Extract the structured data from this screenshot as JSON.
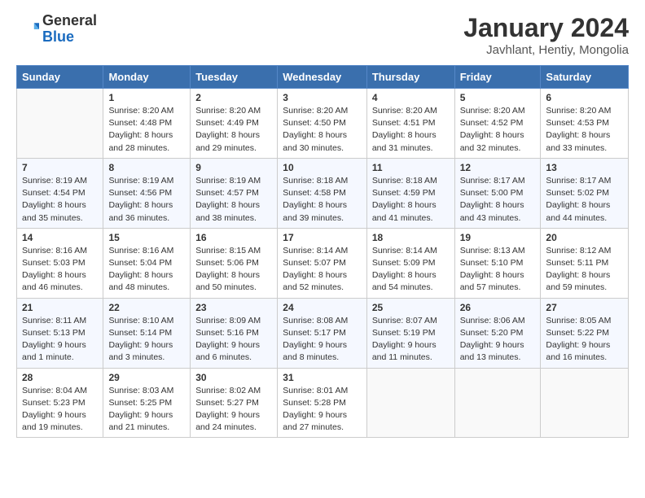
{
  "header": {
    "logo_general": "General",
    "logo_blue": "Blue",
    "month_title": "January 2024",
    "location": "Javhlant, Hentiy, Mongolia"
  },
  "weekdays": [
    "Sunday",
    "Monday",
    "Tuesday",
    "Wednesday",
    "Thursday",
    "Friday",
    "Saturday"
  ],
  "weeks": [
    [
      {
        "day": "",
        "sunrise": "",
        "sunset": "",
        "daylight": ""
      },
      {
        "day": "1",
        "sunrise": "Sunrise: 8:20 AM",
        "sunset": "Sunset: 4:48 PM",
        "daylight": "Daylight: 8 hours and 28 minutes."
      },
      {
        "day": "2",
        "sunrise": "Sunrise: 8:20 AM",
        "sunset": "Sunset: 4:49 PM",
        "daylight": "Daylight: 8 hours and 29 minutes."
      },
      {
        "day": "3",
        "sunrise": "Sunrise: 8:20 AM",
        "sunset": "Sunset: 4:50 PM",
        "daylight": "Daylight: 8 hours and 30 minutes."
      },
      {
        "day": "4",
        "sunrise": "Sunrise: 8:20 AM",
        "sunset": "Sunset: 4:51 PM",
        "daylight": "Daylight: 8 hours and 31 minutes."
      },
      {
        "day": "5",
        "sunrise": "Sunrise: 8:20 AM",
        "sunset": "Sunset: 4:52 PM",
        "daylight": "Daylight: 8 hours and 32 minutes."
      },
      {
        "day": "6",
        "sunrise": "Sunrise: 8:20 AM",
        "sunset": "Sunset: 4:53 PM",
        "daylight": "Daylight: 8 hours and 33 minutes."
      }
    ],
    [
      {
        "day": "7",
        "sunrise": "Sunrise: 8:19 AM",
        "sunset": "Sunset: 4:54 PM",
        "daylight": "Daylight: 8 hours and 35 minutes."
      },
      {
        "day": "8",
        "sunrise": "Sunrise: 8:19 AM",
        "sunset": "Sunset: 4:56 PM",
        "daylight": "Daylight: 8 hours and 36 minutes."
      },
      {
        "day": "9",
        "sunrise": "Sunrise: 8:19 AM",
        "sunset": "Sunset: 4:57 PM",
        "daylight": "Daylight: 8 hours and 38 minutes."
      },
      {
        "day": "10",
        "sunrise": "Sunrise: 8:18 AM",
        "sunset": "Sunset: 4:58 PM",
        "daylight": "Daylight: 8 hours and 39 minutes."
      },
      {
        "day": "11",
        "sunrise": "Sunrise: 8:18 AM",
        "sunset": "Sunset: 4:59 PM",
        "daylight": "Daylight: 8 hours and 41 minutes."
      },
      {
        "day": "12",
        "sunrise": "Sunrise: 8:17 AM",
        "sunset": "Sunset: 5:00 PM",
        "daylight": "Daylight: 8 hours and 43 minutes."
      },
      {
        "day": "13",
        "sunrise": "Sunrise: 8:17 AM",
        "sunset": "Sunset: 5:02 PM",
        "daylight": "Daylight: 8 hours and 44 minutes."
      }
    ],
    [
      {
        "day": "14",
        "sunrise": "Sunrise: 8:16 AM",
        "sunset": "Sunset: 5:03 PM",
        "daylight": "Daylight: 8 hours and 46 minutes."
      },
      {
        "day": "15",
        "sunrise": "Sunrise: 8:16 AM",
        "sunset": "Sunset: 5:04 PM",
        "daylight": "Daylight: 8 hours and 48 minutes."
      },
      {
        "day": "16",
        "sunrise": "Sunrise: 8:15 AM",
        "sunset": "Sunset: 5:06 PM",
        "daylight": "Daylight: 8 hours and 50 minutes."
      },
      {
        "day": "17",
        "sunrise": "Sunrise: 8:14 AM",
        "sunset": "Sunset: 5:07 PM",
        "daylight": "Daylight: 8 hours and 52 minutes."
      },
      {
        "day": "18",
        "sunrise": "Sunrise: 8:14 AM",
        "sunset": "Sunset: 5:09 PM",
        "daylight": "Daylight: 8 hours and 54 minutes."
      },
      {
        "day": "19",
        "sunrise": "Sunrise: 8:13 AM",
        "sunset": "Sunset: 5:10 PM",
        "daylight": "Daylight: 8 hours and 57 minutes."
      },
      {
        "day": "20",
        "sunrise": "Sunrise: 8:12 AM",
        "sunset": "Sunset: 5:11 PM",
        "daylight": "Daylight: 8 hours and 59 minutes."
      }
    ],
    [
      {
        "day": "21",
        "sunrise": "Sunrise: 8:11 AM",
        "sunset": "Sunset: 5:13 PM",
        "daylight": "Daylight: 9 hours and 1 minute."
      },
      {
        "day": "22",
        "sunrise": "Sunrise: 8:10 AM",
        "sunset": "Sunset: 5:14 PM",
        "daylight": "Daylight: 9 hours and 3 minutes."
      },
      {
        "day": "23",
        "sunrise": "Sunrise: 8:09 AM",
        "sunset": "Sunset: 5:16 PM",
        "daylight": "Daylight: 9 hours and 6 minutes."
      },
      {
        "day": "24",
        "sunrise": "Sunrise: 8:08 AM",
        "sunset": "Sunset: 5:17 PM",
        "daylight": "Daylight: 9 hours and 8 minutes."
      },
      {
        "day": "25",
        "sunrise": "Sunrise: 8:07 AM",
        "sunset": "Sunset: 5:19 PM",
        "daylight": "Daylight: 9 hours and 11 minutes."
      },
      {
        "day": "26",
        "sunrise": "Sunrise: 8:06 AM",
        "sunset": "Sunset: 5:20 PM",
        "daylight": "Daylight: 9 hours and 13 minutes."
      },
      {
        "day": "27",
        "sunrise": "Sunrise: 8:05 AM",
        "sunset": "Sunset: 5:22 PM",
        "daylight": "Daylight: 9 hours and 16 minutes."
      }
    ],
    [
      {
        "day": "28",
        "sunrise": "Sunrise: 8:04 AM",
        "sunset": "Sunset: 5:23 PM",
        "daylight": "Daylight: 9 hours and 19 minutes."
      },
      {
        "day": "29",
        "sunrise": "Sunrise: 8:03 AM",
        "sunset": "Sunset: 5:25 PM",
        "daylight": "Daylight: 9 hours and 21 minutes."
      },
      {
        "day": "30",
        "sunrise": "Sunrise: 8:02 AM",
        "sunset": "Sunset: 5:27 PM",
        "daylight": "Daylight: 9 hours and 24 minutes."
      },
      {
        "day": "31",
        "sunrise": "Sunrise: 8:01 AM",
        "sunset": "Sunset: 5:28 PM",
        "daylight": "Daylight: 9 hours and 27 minutes."
      },
      {
        "day": "",
        "sunrise": "",
        "sunset": "",
        "daylight": ""
      },
      {
        "day": "",
        "sunrise": "",
        "sunset": "",
        "daylight": ""
      },
      {
        "day": "",
        "sunrise": "",
        "sunset": "",
        "daylight": ""
      }
    ]
  ]
}
